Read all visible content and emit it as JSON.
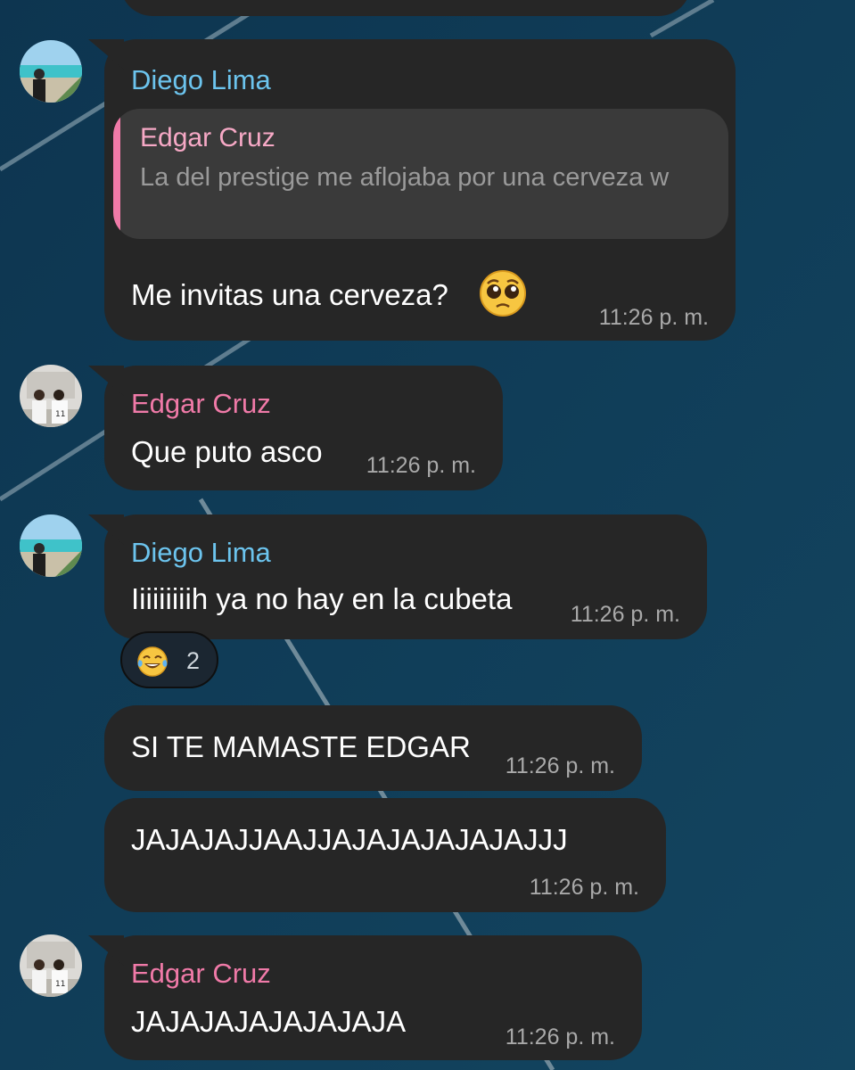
{
  "messages": [
    {
      "sender": "Diego Lima",
      "reply": {
        "name": "Edgar Cruz",
        "text": "La del prestige me aflojaba por una cerveza w"
      },
      "text": "Me invitas una cerveza?",
      "emoji_icon": "pleading-face-emoji",
      "time": "11:26 p. m."
    },
    {
      "sender": "Edgar Cruz",
      "text": "Que puto asco",
      "time": "11:26 p. m."
    },
    {
      "sender": "Diego Lima",
      "text": "Iiiiiiiiih ya no hay en la cubeta",
      "time": "11:26 p. m.",
      "reaction": {
        "icon": "tears-of-joy-emoji",
        "count": "2"
      }
    },
    {
      "text": "SI TE MAMASTE EDGAR",
      "time": "11:26 p. m."
    },
    {
      "text": "JAJAJAJJAAJJAJAJAJAJAJAJJJ",
      "time": "11:26 p. m."
    },
    {
      "sender": "Edgar Cruz",
      "text": "JAJAJAJAJAJAJAJA",
      "time": "11:26 p. m."
    }
  ],
  "colors": {
    "background": "#0f3a52",
    "bubble": "#262626",
    "sender_blue": "#6cc4ee",
    "sender_pink": "#f07aa8",
    "time": "#a9a9a9"
  }
}
